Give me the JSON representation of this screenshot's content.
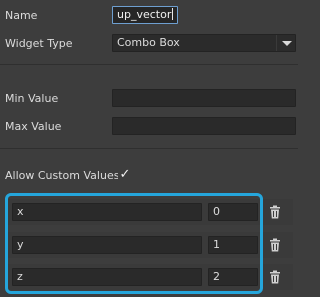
{
  "form": {
    "name_label": "Name",
    "name_value": "up_vector",
    "widget_type_label": "Widget Type",
    "widget_type_value": "Combo Box",
    "min_value_label": "Min Value",
    "max_value_label": "Max Value",
    "allow_custom_label": "Allow Custom Values",
    "allow_custom_checked": true,
    "check_glyph": "✓"
  },
  "custom_values": [
    {
      "label": "x",
      "value": "0"
    },
    {
      "label": "y",
      "value": "1"
    },
    {
      "label": "z",
      "value": "2"
    }
  ],
  "icons": {
    "dropdown": "chevron-down-icon",
    "delete": "trash-icon",
    "checkbox": "checkmark-icon"
  },
  "colors": {
    "background": "#3d3d3d",
    "field": "#2a2a2a",
    "focus_border": "#6e9fd0",
    "highlight": "#25a6dc"
  }
}
